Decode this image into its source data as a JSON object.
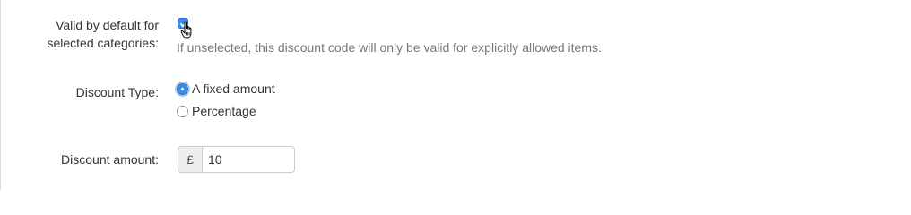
{
  "valid_by_default": {
    "label_line1": "Valid by default for",
    "label_line2": "selected categories:",
    "checked": true,
    "help_text": "If unselected, this discount code will only be valid for explicitly allowed items."
  },
  "discount_type": {
    "label": "Discount Type:",
    "options": [
      {
        "label": "A fixed amount",
        "selected": true
      },
      {
        "label": "Percentage",
        "selected": false
      }
    ]
  },
  "discount_amount": {
    "label": "Discount amount:",
    "currency_symbol": "£",
    "value": "10"
  },
  "colors": {
    "accent": "#3b8ee8",
    "help_text": "#777777",
    "label_text": "#333333"
  },
  "icons": {
    "cursor": "hand-pointer-icon"
  }
}
